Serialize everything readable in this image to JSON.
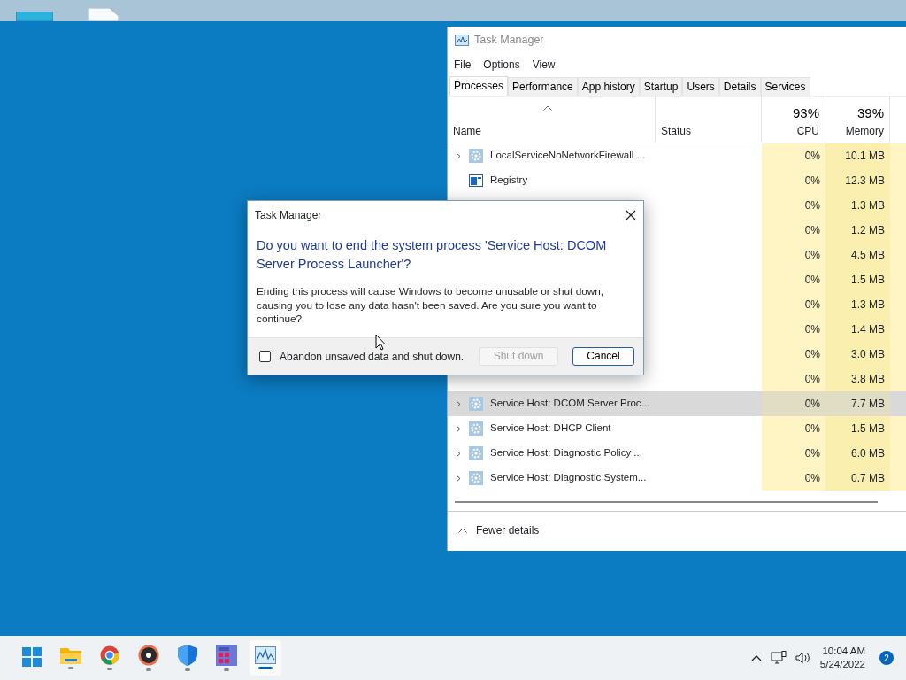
{
  "task_manager": {
    "title": "Task Manager",
    "menu": [
      "File",
      "Options",
      "View"
    ],
    "tabs": [
      {
        "label": "Processes",
        "selected": true
      },
      {
        "label": "Performance",
        "selected": false
      },
      {
        "label": "App history",
        "selected": false
      },
      {
        "label": "Startup",
        "selected": false
      },
      {
        "label": "Users",
        "selected": false
      },
      {
        "label": "Details",
        "selected": false
      },
      {
        "label": "Services",
        "selected": false
      }
    ],
    "columns": {
      "name": "Name",
      "status": "Status",
      "cpu_total": "93%",
      "cpu": "CPU",
      "memory_total": "39%",
      "memory": "Memory"
    },
    "rows": [
      {
        "name": "LocalServiceNoNetworkFirewall ...",
        "kind": "service",
        "expandable": true,
        "selected": false,
        "cpu": "0%",
        "memory": "10.1 MB"
      },
      {
        "name": "Registry",
        "kind": "app",
        "expandable": false,
        "selected": false,
        "cpu": "0%",
        "memory": "12.3 MB"
      },
      {
        "selected": false,
        "cpu": "0%",
        "memory": "1.3 MB"
      },
      {
        "selected": false,
        "cpu": "0%",
        "memory": "1.2 MB"
      },
      {
        "selected": false,
        "cpu": "0%",
        "memory": "4.5 MB"
      },
      {
        "selected": false,
        "cpu": "0%",
        "memory": "1.5 MB"
      },
      {
        "selected": false,
        "cpu": "0%",
        "memory": "1.3 MB"
      },
      {
        "selected": false,
        "cpu": "0%",
        "memory": "1.4 MB"
      },
      {
        "selected": false,
        "cpu": "0%",
        "memory": "3.0 MB"
      },
      {
        "selected": false,
        "cpu": "0%",
        "memory": "3.8 MB"
      },
      {
        "name": "Service Host: DCOM Server Proc...",
        "kind": "service",
        "expandable": true,
        "selected": true,
        "cpu": "0%",
        "memory": "7.7 MB"
      },
      {
        "name": "Service Host: DHCP Client",
        "kind": "service",
        "expandable": true,
        "selected": false,
        "cpu": "0%",
        "memory": "1.5 MB"
      },
      {
        "name": "Service Host: Diagnostic Policy ...",
        "kind": "service",
        "expandable": true,
        "selected": false,
        "cpu": "0%",
        "memory": "6.0 MB"
      },
      {
        "name": "Service Host: Diagnostic System...",
        "kind": "service",
        "expandable": true,
        "selected": false,
        "cpu": "0%",
        "memory": "0.7 MB"
      }
    ],
    "fewer_details": "Fewer details"
  },
  "dialog": {
    "title": "Task Manager",
    "heading": "Do you want to end the system process 'Service Host: DCOM Server Process Launcher'?",
    "message": "Ending this process will cause Windows to become unusable or shut down, causing you to lose any data hasn't been saved. Are you sure you want to continue?",
    "checkbox": {
      "label": "Abandon unsaved data and shut down.",
      "checked": false
    },
    "buttons": [
      {
        "label": "Shut down",
        "disabled": true
      },
      {
        "label": "Cancel",
        "disabled": false
      }
    ]
  },
  "taskbar": {
    "apps": [
      {
        "kind": "start",
        "active": false
      },
      {
        "kind": "folder",
        "active": false
      },
      {
        "kind": "browser",
        "active": false
      },
      {
        "kind": "disc",
        "active": false
      },
      {
        "kind": "shield",
        "active": false
      },
      {
        "kind": "grid",
        "active": false
      },
      {
        "kind": "monitor",
        "active": true
      }
    ],
    "time": "10:04 AM",
    "date": "5/24/2022",
    "notifications": "2"
  }
}
